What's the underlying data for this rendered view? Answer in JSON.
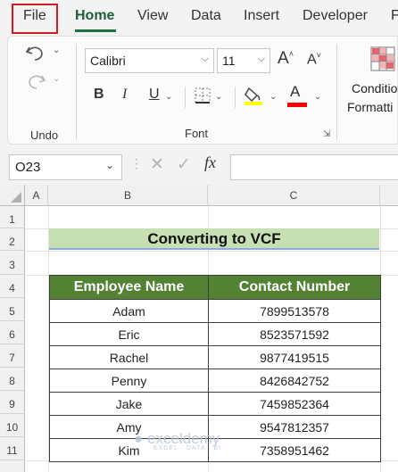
{
  "menu": {
    "file": "File",
    "tabs": [
      "Home",
      "View",
      "Data",
      "Insert",
      "Developer",
      "F"
    ]
  },
  "ribbon": {
    "undo_group_label": "Undo",
    "font_group_label": "Font",
    "font_name": "Calibri",
    "font_size": "11",
    "bold": "B",
    "italic": "I",
    "underline": "U",
    "font_color_glyph": "A",
    "conditional_formatting": [
      "Conditio",
      "Formatti"
    ],
    "highlight_color": "#ffff00",
    "font_color": "#ff0000"
  },
  "formula_bar": {
    "name_box": "O23",
    "fx": "fx",
    "value": ""
  },
  "sheet": {
    "columns": [
      "A",
      "B",
      "C"
    ],
    "rows": [
      "1",
      "2",
      "3",
      "4",
      "5",
      "6",
      "7",
      "8",
      "9",
      "10",
      "11"
    ],
    "title": "Converting to VCF",
    "headers": [
      "Employee Name",
      "Contact Number"
    ],
    "records": [
      [
        "Adam",
        "7899513578"
      ],
      [
        "Eric",
        "8523571592"
      ],
      [
        "Rachel",
        "9877419515"
      ],
      [
        "Penny",
        "8426842752"
      ],
      [
        "Jake",
        "7459852364"
      ],
      [
        "Amy",
        "9547812357"
      ],
      [
        "Kim",
        "7358951462"
      ]
    ]
  },
  "watermark": {
    "name": "exceldemy",
    "tagline": "EXCEL · DATA · BI"
  }
}
